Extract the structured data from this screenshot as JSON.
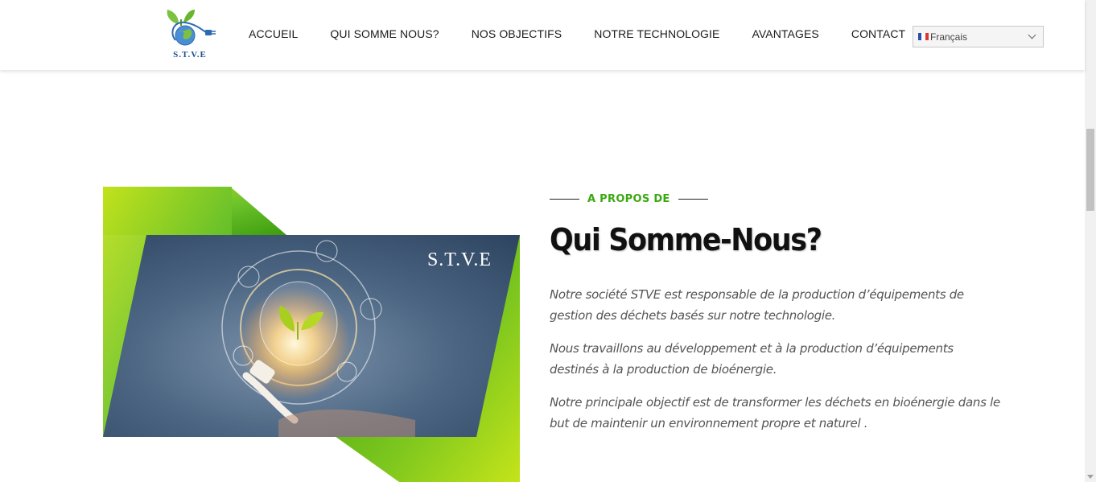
{
  "header": {
    "logo_text": "S.T.V.E",
    "nav": [
      "ACCUEIL",
      "QUI SOMME NOUS?",
      "NOS OBJECTIFS",
      "NOTRE TECHNOLOGIE",
      "AVANTAGES",
      "CONTACT"
    ],
    "language": {
      "selected": "Français",
      "flag_icon": "france-flag-icon"
    }
  },
  "about": {
    "eyebrow": "A PROPOS DE",
    "title": "Qui Somme-Nous?",
    "paragraphs": [
      "Notre société  STVE est responsable de la production d’équipements de gestion des déchets basés sur notre technologie.",
      "Nous travaillons au développement et à la production d’équipements destinés à la production de bioénergie.",
      "Notre principale objectif est de transformer les déchets en bioénergie  dans le but de maintenir un environnement propre et  naturel ."
    ],
    "image_caption": "S.T.V.E"
  },
  "colors": {
    "accent_green": "#3aa810",
    "gradient_green_light": "#b4dc1e",
    "gradient_green_dark": "#3c9c0e",
    "logo_blue": "#1f4f8f"
  }
}
